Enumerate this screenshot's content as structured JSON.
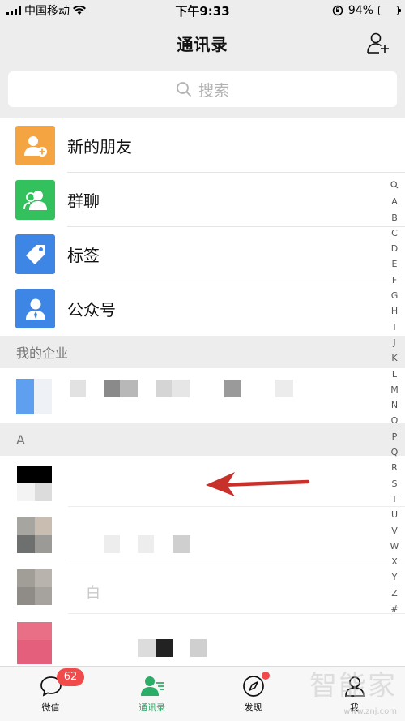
{
  "status_bar": {
    "carrier": "中国移动",
    "time": "下午9:33",
    "battery": "94%",
    "battery_level": 0.94
  },
  "nav": {
    "title": "通讯录"
  },
  "search": {
    "placeholder": "搜索"
  },
  "functions": [
    {
      "label": "新的朋友",
      "icon": "new-friend-icon",
      "color": "#f4a440"
    },
    {
      "label": "群聊",
      "icon": "group-chat-icon",
      "color": "#33c15d"
    },
    {
      "label": "标签",
      "icon": "tag-icon",
      "color": "#3d86e6"
    },
    {
      "label": "公众号",
      "icon": "official-account-icon",
      "color": "#3d86e6"
    }
  ],
  "sections": {
    "enterprise": "我的企业",
    "a": "A"
  },
  "contacts_partial": {
    "row3_text": "白"
  },
  "index_letters": [
    "A",
    "B",
    "C",
    "D",
    "E",
    "F",
    "G",
    "H",
    "I",
    "J",
    "K",
    "L",
    "M",
    "N",
    "O",
    "P",
    "Q",
    "R",
    "S",
    "T",
    "U",
    "V",
    "W",
    "X",
    "Y",
    "Z",
    "#"
  ],
  "tabbar": {
    "tabs": [
      {
        "label": "微信",
        "icon": "chat-bubble-icon",
        "badge": "62"
      },
      {
        "label": "通讯录",
        "icon": "contacts-icon",
        "active": true
      },
      {
        "label": "发现",
        "icon": "compass-icon",
        "dot": true
      },
      {
        "label": "我",
        "icon": "profile-icon"
      }
    ]
  },
  "watermark": {
    "text": "智能家",
    "url": "www.znj.com"
  },
  "colors": {
    "accent": "#2aae67",
    "badge": "#f04a4a",
    "arrow": "#c8302a"
  }
}
